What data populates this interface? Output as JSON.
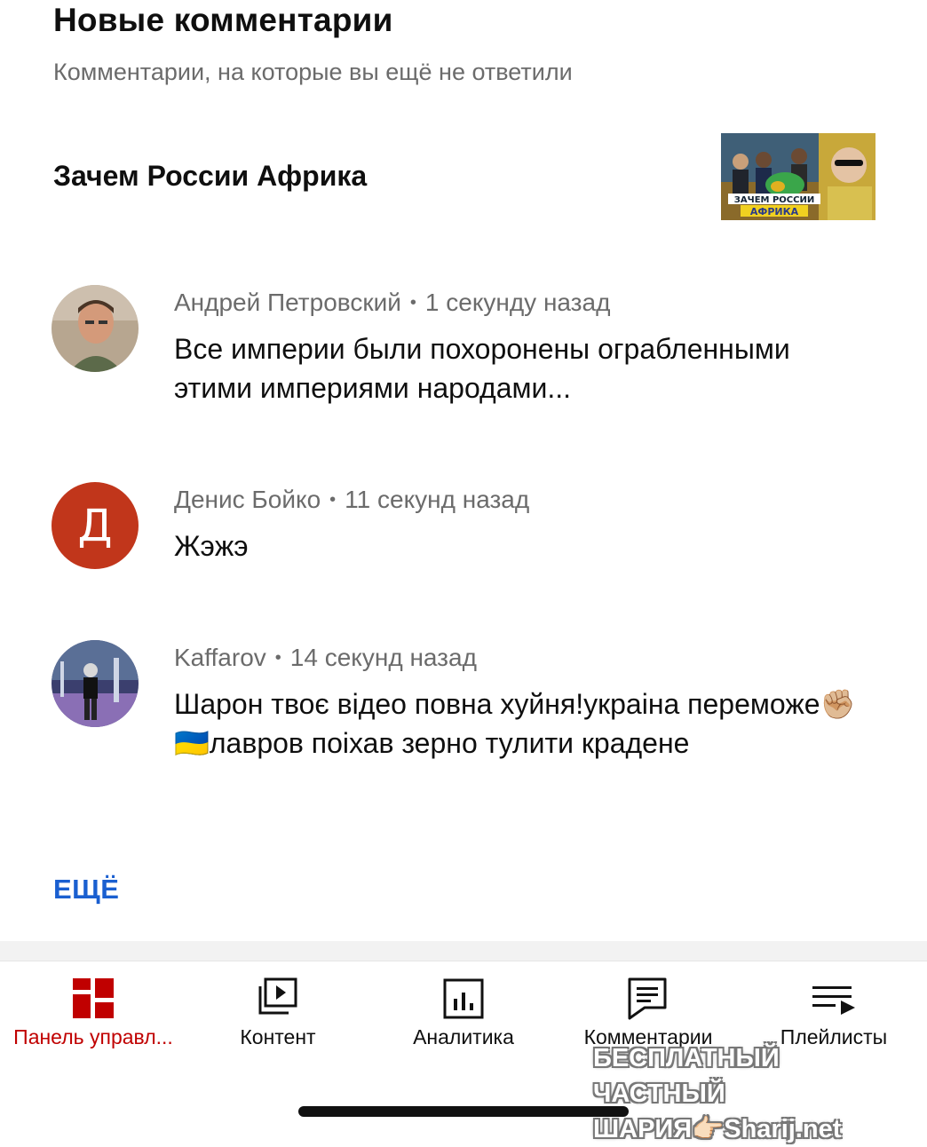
{
  "header": {
    "title": "Новые комментарии",
    "subtitle": "Комментарии, на которые вы ещё не ответили"
  },
  "video": {
    "title": "Зачем России Африка",
    "thumbnail_text_line1": "ЗАЧЕМ РОССИИ",
    "thumbnail_text_line2": "АФРИКА"
  },
  "comments": [
    {
      "author": "Андрей Петровский",
      "time": "1 секунду назад",
      "text": "Все империи были похоронены ограбленными этими империями народами..."
    },
    {
      "author": "Денис Бойко",
      "time": "11 секунд назад",
      "avatar_letter": "Д",
      "avatar_color": "#c1361b",
      "text": "Жэжэ"
    },
    {
      "author": "Kaffarov",
      "time": "14 секунд назад",
      "text": "Шарон твоє відео повна хуйня!украіна переможе✊🏼 🇺🇦лавров поіхав зерно тулити крадене"
    }
  ],
  "more_label": "ЕЩЁ",
  "tabs": [
    {
      "label": "Панель управл...",
      "icon": "dashboard-icon",
      "active": true
    },
    {
      "label": "Контент",
      "icon": "content-icon",
      "active": false
    },
    {
      "label": "Аналитика",
      "icon": "analytics-icon",
      "active": false
    },
    {
      "label": "Комментарии",
      "icon": "comments-icon",
      "active": false
    },
    {
      "label": "Плейлисты",
      "icon": "playlists-icon",
      "active": false
    }
  ],
  "watermark": {
    "line1": "БЕСПЛАТНЫЙ ЧАСТНЫЙ",
    "line2": "ШАРИЯ👉🏻Sharij.net"
  },
  "colors": {
    "accent_red": "#c00000",
    "link_blue": "#1a5fd0",
    "secondary_text": "#6b6b6b"
  }
}
